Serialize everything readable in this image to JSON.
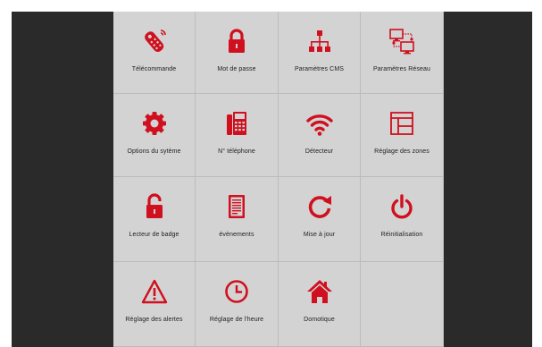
{
  "theme": {
    "accent": "#d0101e",
    "tile_bg": "#d3d3d3",
    "frame_bg": "#2a2a2a"
  },
  "menu": {
    "items": [
      {
        "label": "Télécommande",
        "icon": "remote-control-icon"
      },
      {
        "label": "Mot de passe",
        "icon": "padlock-icon"
      },
      {
        "label": "Paramètres CMS",
        "icon": "hierarchy-icon"
      },
      {
        "label": "Paramètres Réseau",
        "icon": "network-icon"
      },
      {
        "label": "Options du sytème",
        "icon": "gear-icon"
      },
      {
        "label": "N° téléphone",
        "icon": "desk-phone-icon"
      },
      {
        "label": "Détecteur",
        "icon": "wifi-icon"
      },
      {
        "label": "Réglage des zones",
        "icon": "zones-icon"
      },
      {
        "label": "Lecteur de badge",
        "icon": "unlocked-padlock-icon"
      },
      {
        "label": "évènements",
        "icon": "document-icon"
      },
      {
        "label": "Mise à jour",
        "icon": "refresh-icon"
      },
      {
        "label": "Réinitialisation",
        "icon": "power-icon"
      },
      {
        "label": "Réglage des alertes",
        "icon": "warning-icon"
      },
      {
        "label": "Réglage de l'heure",
        "icon": "clock-icon"
      },
      {
        "label": "Domotique",
        "icon": "home-icon"
      }
    ]
  }
}
